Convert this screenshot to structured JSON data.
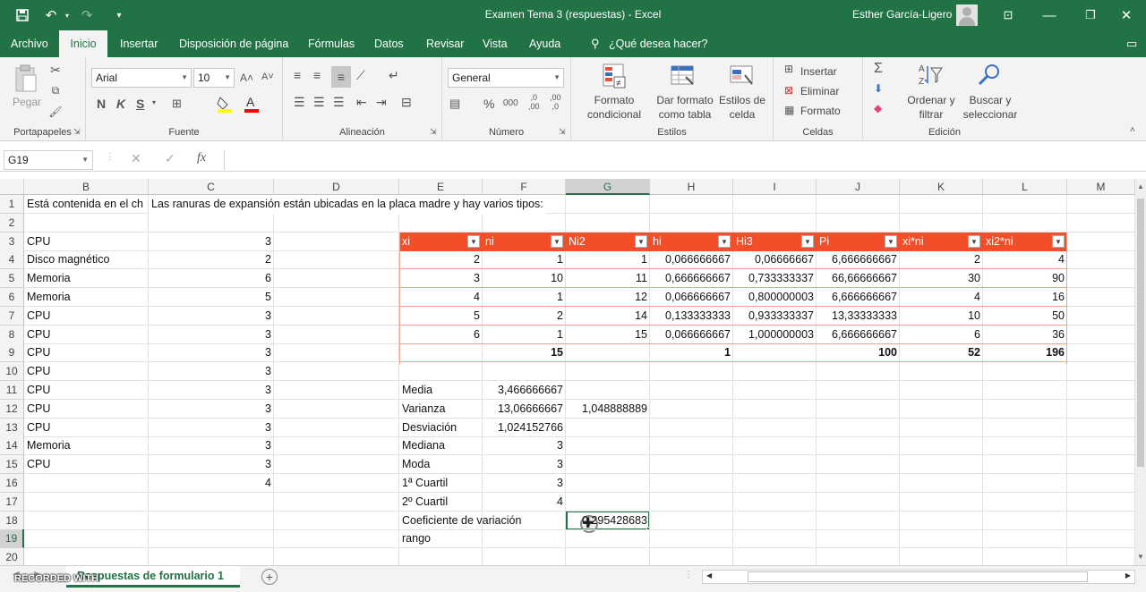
{
  "window": {
    "title": "Examen Tema 3 (respuestas)  -  Excel",
    "user": "Esther García-Ligero"
  },
  "tabs": [
    "Archivo",
    "Inicio",
    "Insertar",
    "Disposición de página",
    "Fórmulas",
    "Datos",
    "Revisar",
    "Vista",
    "Ayuda",
    "¿Qué desea hacer?"
  ],
  "ribbon": {
    "clipboard": {
      "label": "Portapapeles",
      "paste": "Pegar"
    },
    "font": {
      "label": "Fuente",
      "name": "Arial",
      "size": "10",
      "bold": "N",
      "italic": "K",
      "underline": "S",
      "color_accent": "#ff0000",
      "fill_accent": "#ffff00"
    },
    "alignment": {
      "label": "Alineación"
    },
    "number": {
      "label": "Número",
      "format": "General",
      "percent": "%",
      "thousands": "000",
      "inc_dec": ",0\n,00",
      "dec_dec": ",00\n,0"
    },
    "styles": {
      "label": "Estilos",
      "conditional": "Formato\ncondicional",
      "as_table": "Dar formato\ncomo tabla",
      "cell_styles": "Estilos de\ncelda"
    },
    "cells": {
      "label": "Celdas",
      "insert": "Insertar",
      "delete": "Eliminar",
      "format": "Formato"
    },
    "editing": {
      "label": "Edición",
      "sort": "Ordenar y\nfiltrar",
      "find": "Buscar y\nseleccionar"
    }
  },
  "formula_bar": {
    "name_box": "G19",
    "fx": "fx",
    "value": ""
  },
  "columns": [
    "B",
    "C",
    "D",
    "E",
    "F",
    "G",
    "H",
    "I",
    "J",
    "K",
    "L",
    "M"
  ],
  "selected_column": "G",
  "rows": [
    "1",
    "2",
    "3",
    "4",
    "5",
    "6",
    "7",
    "8",
    "9",
    "10",
    "11",
    "12",
    "13",
    "14",
    "15",
    "16",
    "17",
    "18",
    "19",
    "20",
    "21"
  ],
  "selected_row": "19",
  "cells": {
    "A1": "Está contenida en el ch",
    "C1": "Las ranuras de expansión están ubicadas en la placa madre y hay varios tipos:",
    "B": [
      "CPU",
      "Disco magnético",
      "Memoria",
      "Memoria",
      "CPU",
      "CPU",
      "CPU",
      "CPU",
      "CPU",
      "CPU",
      "CPU",
      "Memoria",
      "CPU",
      ""
    ],
    "C": [
      "3",
      "2",
      "6",
      "5",
      "3",
      "3",
      "3",
      "3",
      "3",
      "3",
      "3",
      "3",
      "3",
      "4"
    ]
  },
  "table": {
    "headers": [
      "xi",
      "ni",
      "Ni2",
      "hi",
      "Hi3",
      "Pi",
      "xi*ni",
      "xi2*ni"
    ],
    "header_color": "#f24e29",
    "rows": [
      [
        "2",
        "1",
        "1",
        "0,066666667",
        "0,06666667",
        "6,666666667",
        "2",
        "4"
      ],
      [
        "3",
        "10",
        "11",
        "0,666666667",
        "0,733333337",
        "66,66666667",
        "30",
        "90"
      ],
      [
        "4",
        "1",
        "12",
        "0,066666667",
        "0,800000003",
        "6,666666667",
        "4",
        "16"
      ],
      [
        "5",
        "2",
        "14",
        "0,133333333",
        "0,933333337",
        "13,33333333",
        "10",
        "50"
      ],
      [
        "6",
        "1",
        "15",
        "0,066666667",
        "1,000000003",
        "6,666666667",
        "6",
        "36"
      ]
    ],
    "totals": [
      "",
      "15",
      "",
      "1",
      "",
      "100",
      "52",
      "196"
    ]
  },
  "stats": [
    {
      "label": "Media",
      "value": "3,466666667",
      "extra": ""
    },
    {
      "label": "Varianza",
      "value": "13,06666667",
      "extra": "1,048888889"
    },
    {
      "label": "Desviación",
      "value": "1,024152766",
      "extra": ""
    },
    {
      "label": "Mediana",
      "value": "3",
      "extra": ""
    },
    {
      "label": "Moda",
      "value": "3",
      "extra": ""
    },
    {
      "label": "1ª Cuartil",
      "value": "3",
      "extra": ""
    },
    {
      "label": "2º Cuartil",
      "value": "4",
      "extra": ""
    },
    {
      "label": "Coeficiente de variación",
      "value": "",
      "extra": "0,295428683"
    },
    {
      "label": "rango",
      "value": "",
      "extra": ""
    }
  ],
  "sheet": {
    "tab": "Respuestas de formulario 1",
    "watermark": "RECORDED WITH"
  }
}
